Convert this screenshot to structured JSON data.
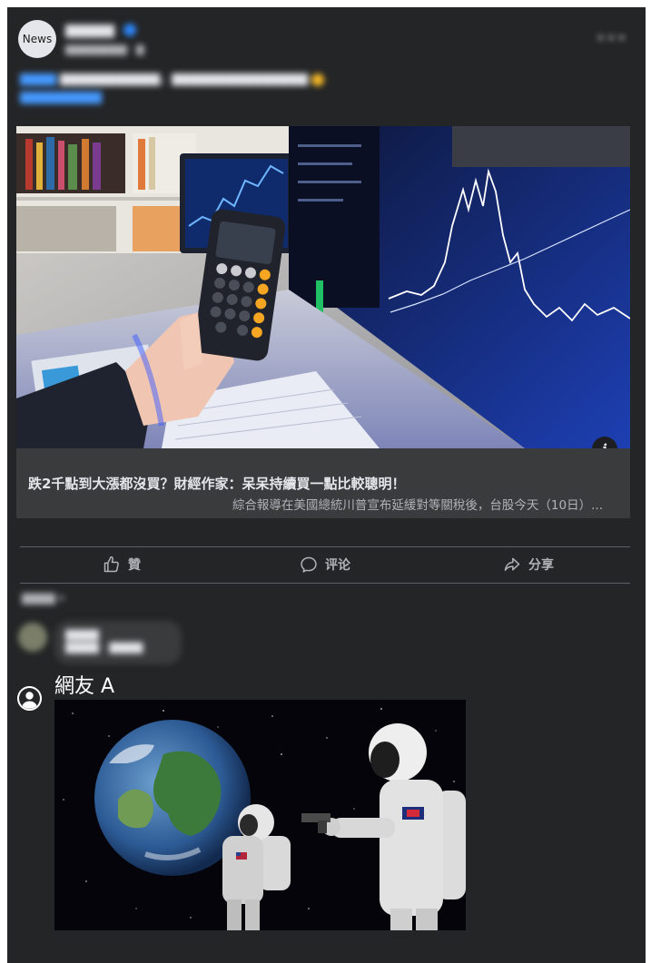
{
  "post": {
    "page_avatar_text": "News",
    "page_name": "",
    "post_meta": "",
    "post_text": "",
    "more_icon": "more-horizontal-icon"
  },
  "link_preview": {
    "title": "跌2千點到大漲都沒買？財經作家：呆呆持續買一點比較聰明！",
    "description": "綜合報導在美國總統川普宣布延緩對等關稅後，台股今天（10日）...",
    "info_icon_text": "i"
  },
  "actions": {
    "like_label": "贊",
    "comment_label": "评论",
    "share_label": "分享"
  },
  "comments": {
    "sort_label": "",
    "blurred_comment": "",
    "commenter_name": "網友 A"
  },
  "colors": {
    "background": "#242526",
    "card": "#3a3b3c",
    "text_primary": "#e4e6eb",
    "text_secondary": "#b0b3b8",
    "accent": "#2d88ff"
  }
}
